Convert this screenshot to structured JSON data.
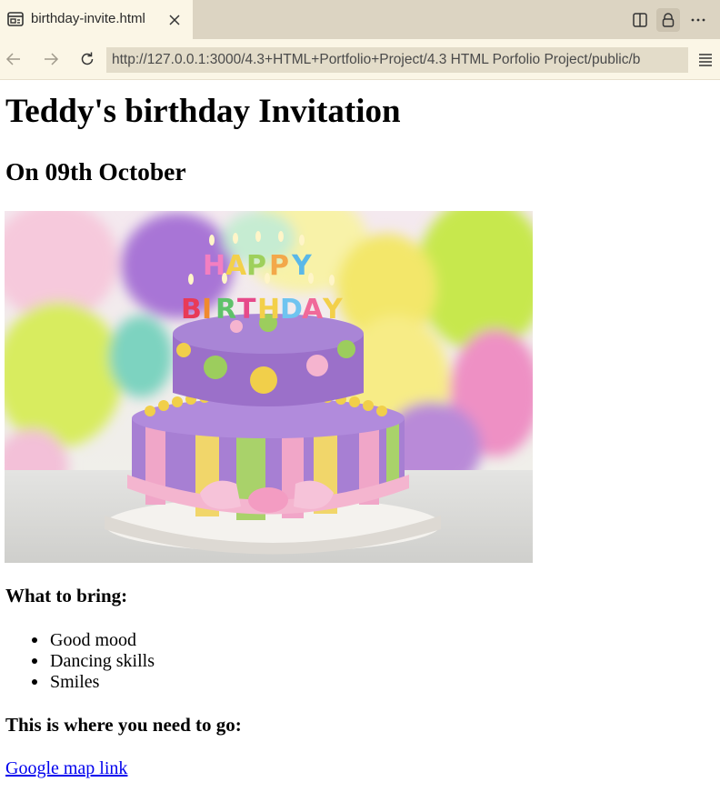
{
  "browser": {
    "tab": {
      "title": "birthday-invite.html"
    },
    "address_bar": {
      "url": "http://127.0.0.1:3000/4.3+HTML+Portfolio+Project/4.3 HTML Porfolio Project/public/b"
    },
    "icons": {
      "favicon": "page-icon",
      "close": "close-icon",
      "split": "split-view-icon",
      "lock": "lock-icon",
      "more": "more-icon",
      "back": "back-arrow-icon",
      "forward": "forward-arrow-icon",
      "reload": "reload-icon",
      "menu": "menu-icon"
    }
  },
  "page": {
    "title": "Teddy's birthday Invitation",
    "date_heading": "On 09th October",
    "image": {
      "subject": "birthday-cake"
    },
    "bring_heading": "What to bring:",
    "bring_items": [
      "Good mood",
      "Dancing skills",
      "Smiles"
    ],
    "location_heading": "This is where you need to go:",
    "map_link": "Google map link"
  },
  "colors": {
    "tabbar": "#dcd4c2",
    "chrome": "#fbf6e6",
    "urlbar": "#e3dcc9",
    "link": "#0000ee"
  }
}
